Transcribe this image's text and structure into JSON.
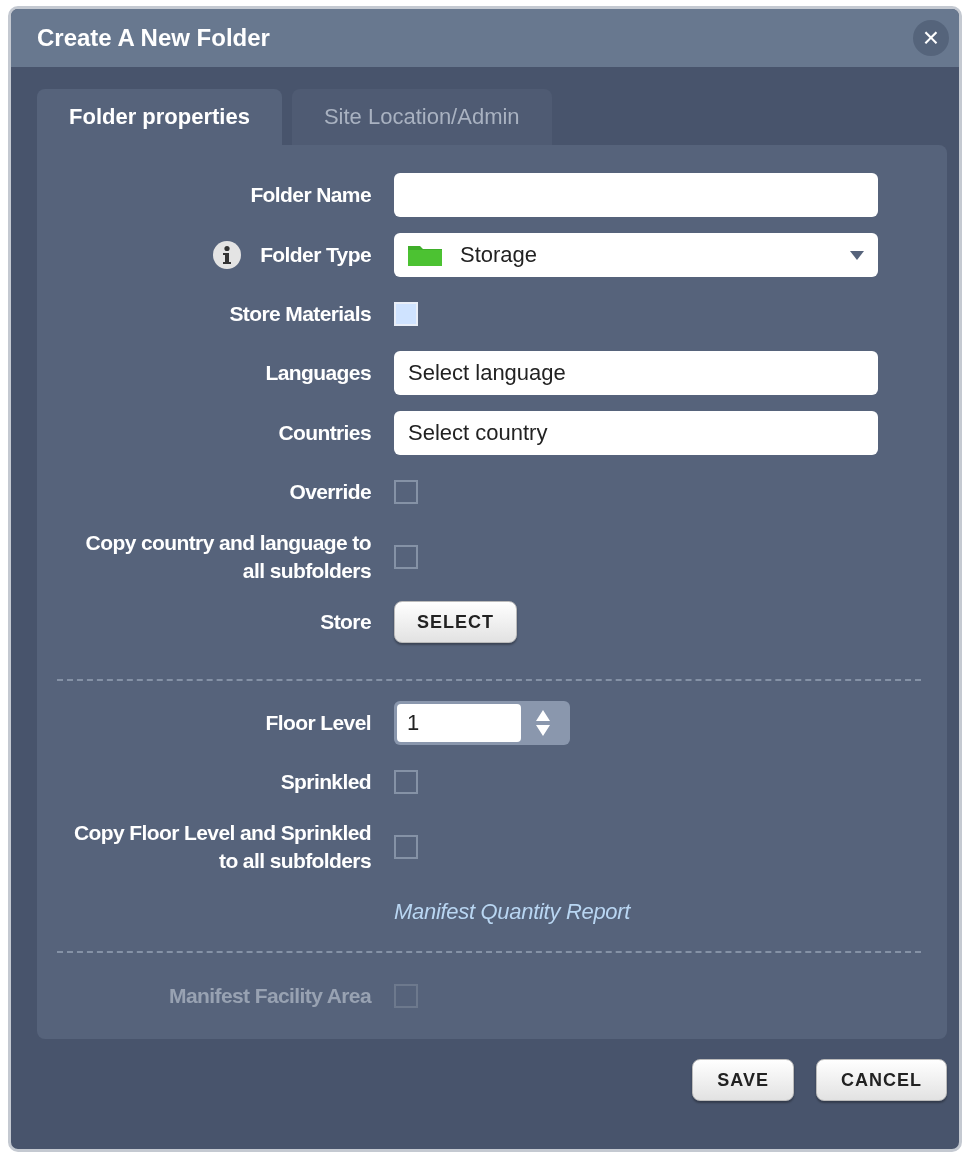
{
  "window": {
    "title": "Create A New Folder",
    "close": "×"
  },
  "tabs": [
    {
      "label": "Folder properties",
      "selected": true
    },
    {
      "label": "Site Location/Admin",
      "selected": false
    }
  ],
  "groups": [
    {
      "rows": [
        {
          "kind": "text",
          "label": "Folder Name"
        },
        {
          "kind": "select",
          "label": "Folder Type",
          "info": true,
          "value": "Storage"
        },
        {
          "kind": "checkbox",
          "label": "Store Materials",
          "checked": true,
          "disabled": false
        },
        {
          "kind": "field",
          "label": "Languages",
          "placeholder": "Select language"
        },
        {
          "kind": "field",
          "label": "Countries",
          "placeholder": "Select country"
        },
        {
          "kind": "checkbox",
          "label": "Override",
          "checked": false,
          "disabled": false
        },
        {
          "kind": "checkbox",
          "label": "Copy country and language to all subfolders",
          "checked": false,
          "disabled": false
        },
        {
          "kind": "button",
          "label": "Store",
          "button": "SELECT"
        }
      ]
    },
    {
      "rows": [
        {
          "kind": "number",
          "label": "Floor Level",
          "value": "1"
        },
        {
          "kind": "checkbox",
          "label": "Sprinkled",
          "checked": false,
          "disabled": false
        },
        {
          "kind": "checkbox",
          "label": "Copy Floor Level and Sprinkled to all subfolders",
          "checked": false,
          "disabled": false
        },
        {
          "kind": "link",
          "text": "Manifest Quantity Report"
        }
      ]
    },
    {
      "rows": [
        {
          "kind": "checkbox",
          "label": "Manifest Facility Area",
          "checked": false,
          "disabled": true
        }
      ]
    }
  ],
  "buttons": [
    "SAVE",
    "CANCEL"
  ]
}
